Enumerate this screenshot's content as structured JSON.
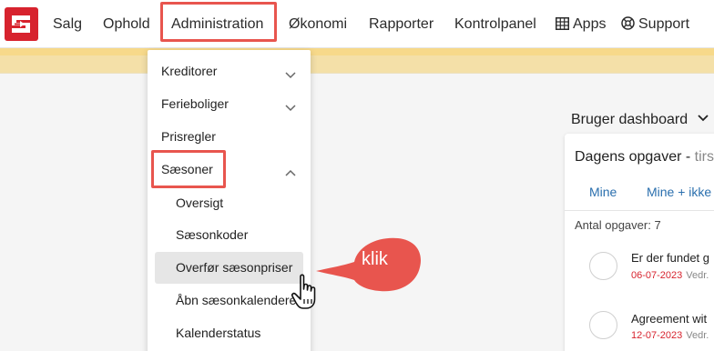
{
  "nav": {
    "items": [
      {
        "label": "Salg"
      },
      {
        "label": "Ophold"
      },
      {
        "label": "Administration"
      },
      {
        "label": "Økonomi"
      },
      {
        "label": "Rapporter"
      },
      {
        "label": "Kontrolpanel"
      },
      {
        "label": "Apps",
        "icon": "grid-icon"
      },
      {
        "label": "Support",
        "icon": "lifebuoy-icon"
      }
    ]
  },
  "dropdown": {
    "sections": [
      {
        "label": "Kreditorer",
        "chevron": "chevron-down-icon"
      },
      {
        "label": "Ferieboliger",
        "chevron": "chevron-down-icon"
      },
      {
        "label": "Prisregler"
      },
      {
        "label": "Sæsoner",
        "chevron": "chevron-up-icon"
      }
    ],
    "sub_items": [
      {
        "label": "Oversigt"
      },
      {
        "label": "Sæsonkoder"
      },
      {
        "label": "Overfør sæsonpriser"
      },
      {
        "label": "Åbn sæsonkalendere"
      },
      {
        "label": "Kalenderstatus"
      }
    ]
  },
  "dashboard": {
    "selector_label": "Bruger dashboard",
    "card": {
      "title": "Dagens opgaver -",
      "title_suffix": "tirs",
      "tabs": [
        {
          "label": "Mine"
        },
        {
          "label": "Mine + ikke"
        }
      ],
      "count_label": "Antal opgaver: 7",
      "tasks": [
        {
          "title": "Er der fundet g",
          "date": "06-07-2023",
          "owner": "Vedr."
        },
        {
          "title": "Agreement wit",
          "date": "12-07-2023",
          "owner": "Vedr."
        }
      ]
    }
  },
  "annotation": {
    "callout_label": "klik"
  },
  "colors": {
    "brand_red": "#d7232e",
    "highlight": "#e8554e",
    "link_blue": "#2a6fae",
    "banner_yellow": "#f4e0a8"
  }
}
